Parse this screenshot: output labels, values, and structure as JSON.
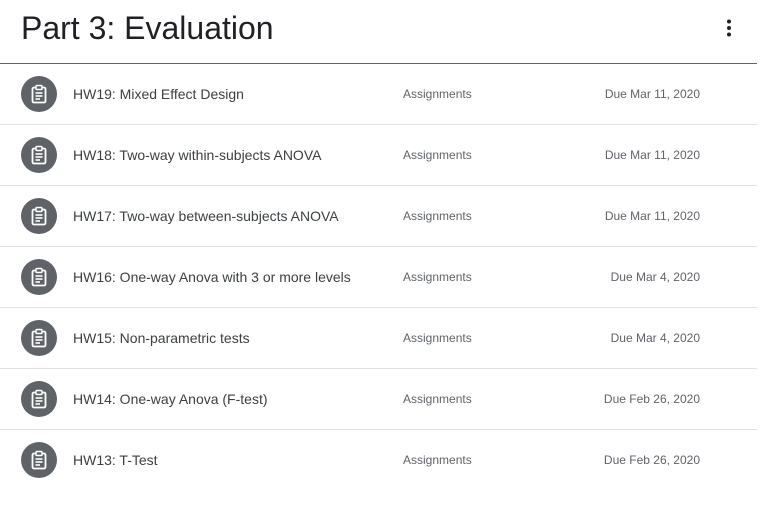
{
  "topic": {
    "title": "Part 3: Evaluation",
    "more_icon": "more-vert-icon"
  },
  "item_icon": "assignment-icon",
  "colors": {
    "icon_circle": "#5f6368",
    "divider": "#e0e0e0",
    "header_rule": "#5f6368"
  },
  "items": [
    {
      "title": "HW19: Mixed Effect Design",
      "type": "Assignments",
      "due": "Due Mar 11, 2020"
    },
    {
      "title": "HW18: Two-way within-subjects ANOVA",
      "type": "Assignments",
      "due": "Due Mar 11, 2020"
    },
    {
      "title": "HW17: Two-way between-subjects ANOVA",
      "type": "Assignments",
      "due": "Due Mar 11, 2020"
    },
    {
      "title": "HW16: One-way Anova with 3 or more levels",
      "type": "Assignments",
      "due": "Due Mar 4, 2020"
    },
    {
      "title": "HW15: Non-parametric tests",
      "type": "Assignments",
      "due": "Due Mar 4, 2020"
    },
    {
      "title": "HW14: One-way Anova (F-test)",
      "type": "Assignments",
      "due": "Due Feb 26, 2020"
    },
    {
      "title": "HW13: T-Test",
      "type": "Assignments",
      "due": "Due Feb 26, 2020"
    }
  ]
}
